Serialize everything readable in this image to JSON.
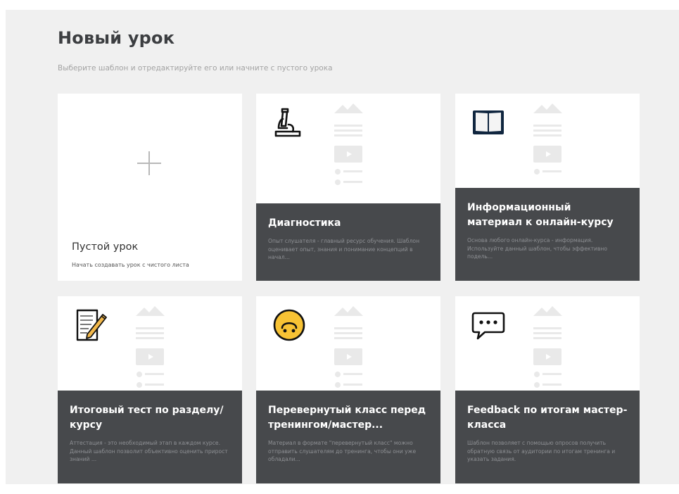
{
  "header": {
    "title": "Новый урок",
    "subtitle": "Выберите шаблон и отредактируйте его или начните с пустого урока"
  },
  "empty_card": {
    "title": "Пустой урок",
    "description": "Начать создавать урок с чистого листа"
  },
  "templates": [
    {
      "icon": "microscope-icon",
      "title": "Диагностика",
      "description": "Опыт слушателя - главный ресурс обучения. Шаблон оценивает опыт, знания и понимание концепций в начал..."
    },
    {
      "icon": "book-icon",
      "title": "Информационный материал к онлайн-курсу",
      "description": "Основа любого онлайн-курса - информация. Используйте данный шаблон, чтобы эффективно подель..."
    },
    {
      "icon": "memo-pencil-icon",
      "title": "Итоговый тест по разделу/ курсу",
      "description": "Аттестация - это необходимый этап в каждом курсе. Данный шаблон позволит объективно оценить прирост знаний ..."
    },
    {
      "icon": "upside-down-face-icon",
      "title": "Перевернутый класс перед тренингом/мастер...",
      "description": "Материал в формате \"перевернутый класс\" можно отправить слушателям до тренинга, чтобы они уже обладали..."
    },
    {
      "icon": "speech-bubble-icon",
      "title": "Feedback по итогам мастер-класса",
      "description": "Шаблон позволяет с помощью опросов получить обратную связь от аудитории по итогам тренинга и указать задания."
    }
  ],
  "colors": {
    "background": "#f0f0f0",
    "card": "#ffffff",
    "overlay": "#47494c",
    "icon_yellow": "#f7c234",
    "ghost_icon": "#e8e8e8"
  }
}
